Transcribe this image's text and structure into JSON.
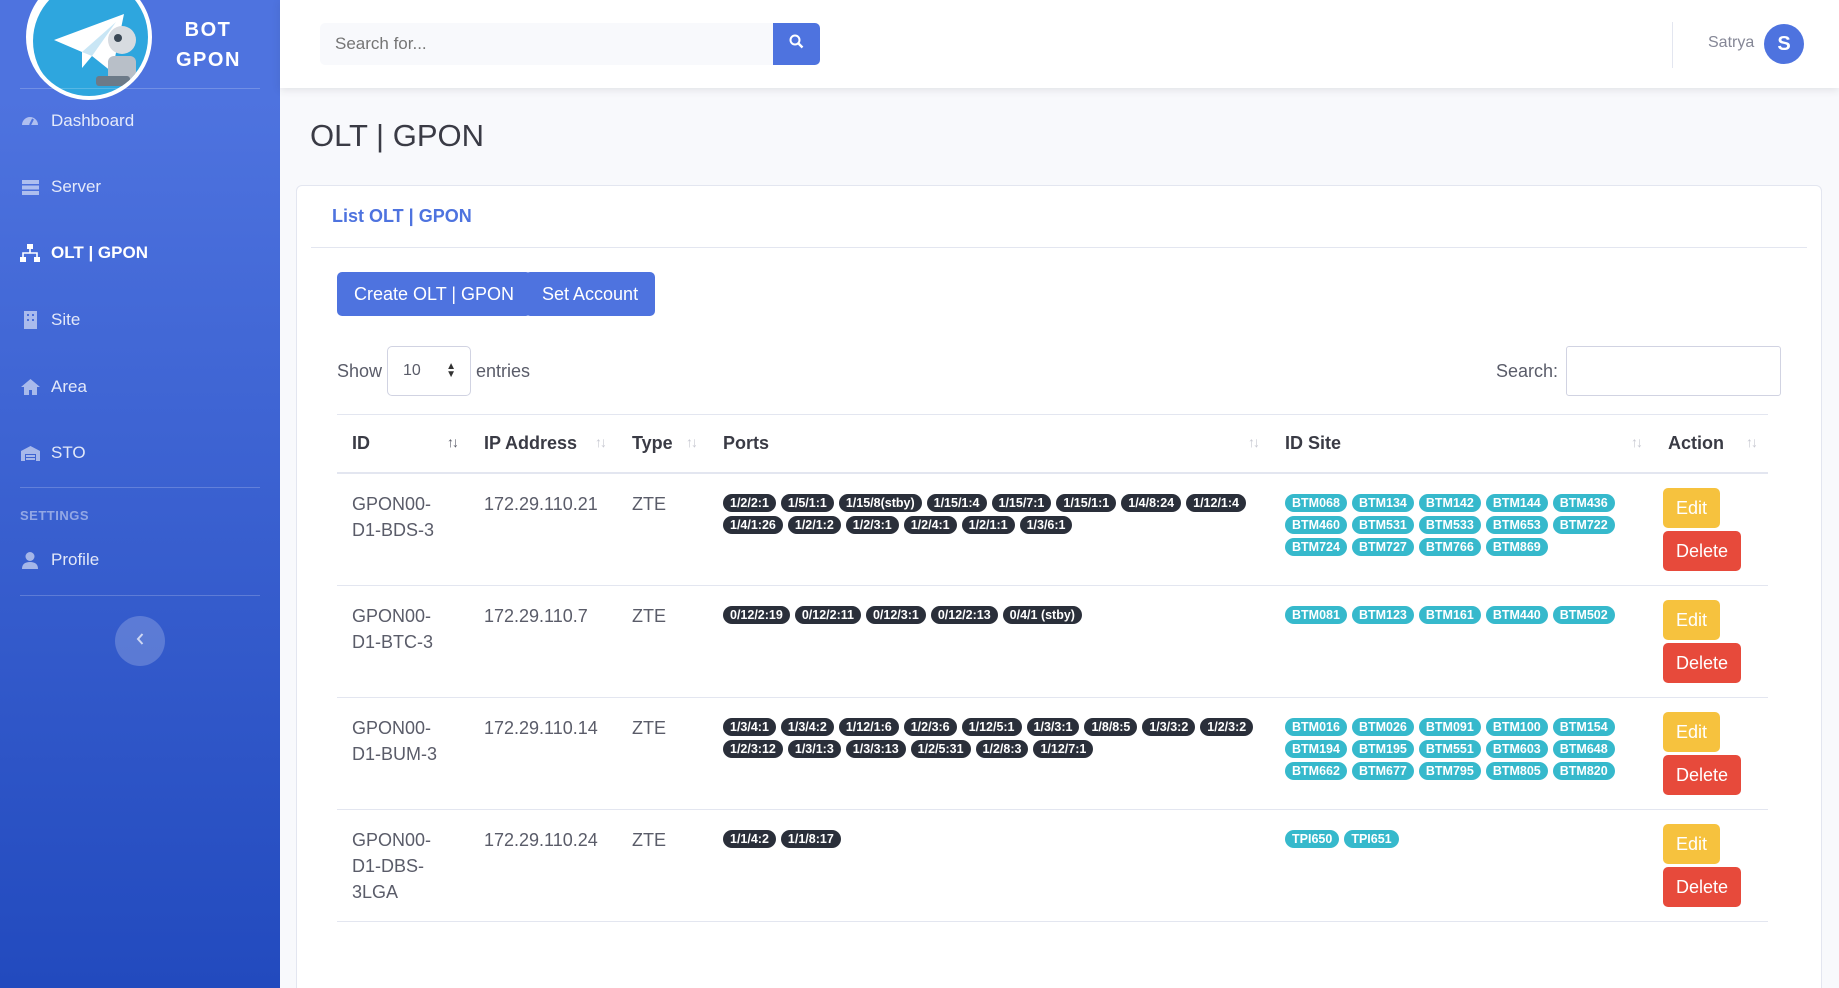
{
  "brand": {
    "line1": "BOT",
    "line2": "GPON"
  },
  "sidebar": {
    "items": [
      {
        "label": "Dashboard",
        "icon": "dashboard-icon"
      },
      {
        "label": "Server",
        "icon": "server-icon"
      },
      {
        "label": "OLT | GPON",
        "icon": "network-icon",
        "active": true
      },
      {
        "label": "Site",
        "icon": "building-icon"
      },
      {
        "label": "Area",
        "icon": "home-icon"
      },
      {
        "label": "STO",
        "icon": "warehouse-icon"
      }
    ],
    "heading": "SETTINGS",
    "settings_items": [
      {
        "label": "Profile",
        "icon": "user-icon"
      }
    ]
  },
  "topbar": {
    "search_placeholder": "Search for...",
    "user_name": "Satrya",
    "avatar_initial": "S"
  },
  "page": {
    "title": "OLT | GPON"
  },
  "card": {
    "header": "List OLT | GPON",
    "create_label": "Create OLT | GPON",
    "set_account_label": "Set Account",
    "show_label": "Show",
    "entries_value": "10",
    "entries_label": "entries",
    "search_label": "Search:"
  },
  "table": {
    "columns": [
      "ID",
      "IP Address",
      "Type",
      "Ports",
      "ID Site",
      "Action"
    ],
    "edit_label": "Edit",
    "delete_label": "Delete",
    "rows": [
      {
        "id": "GPON00-D1-BDS-3",
        "ip": "172.29.110.21",
        "type": "ZTE",
        "ports": [
          "1/2/2:1",
          "1/5/1:1",
          "1/15/8(stby)",
          "1/15/1:4",
          "1/15/7:1",
          "1/15/1:1",
          "1/4/8:24",
          "1/12/1:4",
          "1/4/1:26",
          "1/2/1:2",
          "1/2/3:1",
          "1/2/4:1",
          "1/2/1:1",
          "1/3/6:1"
        ],
        "sites": [
          "BTM068",
          "BTM134",
          "BTM142",
          "BTM144",
          "BTM436",
          "BTM460",
          "BTM531",
          "BTM533",
          "BTM653",
          "BTM722",
          "BTM724",
          "BTM727",
          "BTM766",
          "BTM869"
        ]
      },
      {
        "id": "GPON00-D1-BTC-3",
        "ip": "172.29.110.7",
        "type": "ZTE",
        "ports": [
          "0/12/2:19",
          "0/12/2:11",
          "0/12/3:1",
          "0/12/2:13",
          "0/4/1 (stby)"
        ],
        "sites": [
          "BTM081",
          "BTM123",
          "BTM161",
          "BTM440",
          "BTM502"
        ]
      },
      {
        "id": "GPON00-D1-BUM-3",
        "ip": "172.29.110.14",
        "type": "ZTE",
        "ports": [
          "1/3/4:1",
          "1/3/4:2",
          "1/12/1:6",
          "1/2/3:6",
          "1/12/5:1",
          "1/3/3:1",
          "1/8/8:5",
          "1/3/3:2",
          "1/2/3:2",
          "1/2/3:12",
          "1/3/1:3",
          "1/3/3:13",
          "1/2/5:31",
          "1/2/8:3",
          "1/12/7:1"
        ],
        "sites": [
          "BTM016",
          "BTM026",
          "BTM091",
          "BTM100",
          "BTM154",
          "BTM194",
          "BTM195",
          "BTM551",
          "BTM603",
          "BTM648",
          "BTM662",
          "BTM677",
          "BTM795",
          "BTM805",
          "BTM820"
        ]
      },
      {
        "id": "GPON00-D1-DBS-3LGA",
        "ip": "172.29.110.24",
        "type": "ZTE",
        "ports": [
          "1/1/4:2",
          "1/1/8:17"
        ],
        "sites": [
          "TPI650",
          "TPI651"
        ]
      }
    ]
  },
  "colors": {
    "primary": "#4e73df",
    "warning": "#f6c23e",
    "danger": "#e74a3b",
    "info": "#36b9cc",
    "dark": "#2a2f3a"
  }
}
